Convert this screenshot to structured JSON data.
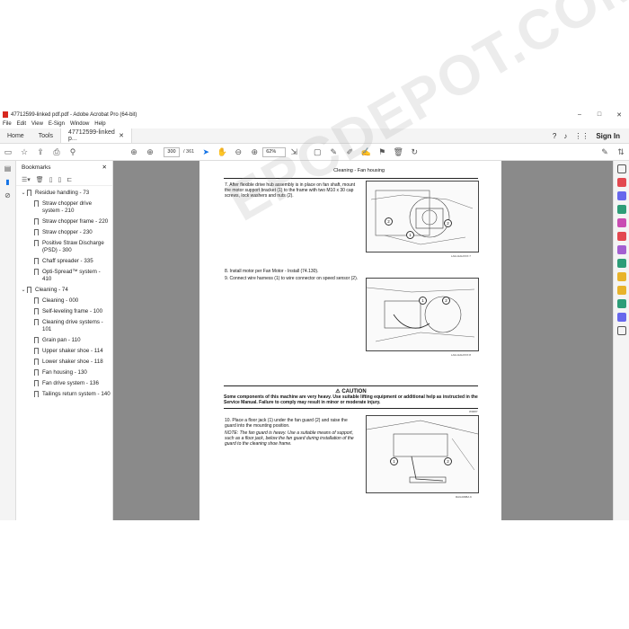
{
  "window": {
    "title": "47712599-linked pdf.pdf - Adobe Acrobat Pro (64-bit)",
    "minimize": "–",
    "maximize": "□",
    "close": "✕"
  },
  "menu": [
    "File",
    "Edit",
    "View",
    "E-Sign",
    "Window",
    "Help"
  ],
  "tabs": {
    "home": "Home",
    "tools": "Tools",
    "doc": "47712599-linked p...",
    "doc_close": "✕",
    "signin": "Sign In"
  },
  "toolbar": {
    "page_current": "300",
    "page_total": "/ 361",
    "zoom": "62%"
  },
  "bookmarks": {
    "title": "Bookmarks",
    "close": "✕",
    "items": [
      {
        "label": "Residue handling - 73",
        "level": 1,
        "expanded": true
      },
      {
        "label": "Straw chopper drive system - 210",
        "level": 2
      },
      {
        "label": "Straw chopper frame - 220",
        "level": 2
      },
      {
        "label": "Straw chopper - 230",
        "level": 2
      },
      {
        "label": "Positive Straw Discharge (PSD) - 300",
        "level": 2
      },
      {
        "label": "Chaff spreader - 335",
        "level": 2
      },
      {
        "label": "Opti-Spread™ system - 410",
        "level": 2
      },
      {
        "label": "Cleaning - 74",
        "level": 1,
        "expanded": true
      },
      {
        "label": "Cleaning - 000",
        "level": 2
      },
      {
        "label": "Self-leveling frame - 100",
        "level": 2
      },
      {
        "label": "Cleaning drive systems - 101",
        "level": 2
      },
      {
        "label": "Grain pan - 110",
        "level": 2
      },
      {
        "label": "Upper shaker shoe - 114",
        "level": 2
      },
      {
        "label": "Lower shaker shoe - 118",
        "level": 2
      },
      {
        "label": "Fan housing - 130",
        "level": 2
      },
      {
        "label": "Fan drive system - 136",
        "level": 2
      },
      {
        "label": "Tailings return system - 140",
        "level": 2
      }
    ]
  },
  "document": {
    "header": "Cleaning - Fan housing",
    "step7": "7.   After flexible drive hub assembly is in place on fan shaft, mount the motor support bracket (1) to the frame with two M10 x 30 cap screws, lock washers and nuts (2).",
    "step8": "8.   Install motor per Fan Motor - Install (74.130).",
    "step9": "9.   Connect wire harness (1) to wire connector on speed sensor (2).",
    "caution_title": "CAUTION",
    "caution_body": "Some components of this machine are very heavy. Use suitable lifting equipment or additional help as instructed in the Service Manual. Failure to comply may result in minor or moderate injury.",
    "caution_code": "W0087",
    "step10": "10.   Place a floor jack (1) under the fan guard (2) and raise the guard into the mounting position.",
    "note": "NOTE: The fan guard is heavy. Use a suitable means of support, such as a floor jack, below the fan guard during installation of the guard to the cleaning shoe frame.",
    "fig1_id": "LAIL11AHXXX   7",
    "fig2_id": "LAIL11AHXXX   8",
    "fig3_id": "RAIL0088A   9",
    "callout_1": "1",
    "callout_2": "2",
    "watermark": "EPCDEPOT.COM"
  }
}
